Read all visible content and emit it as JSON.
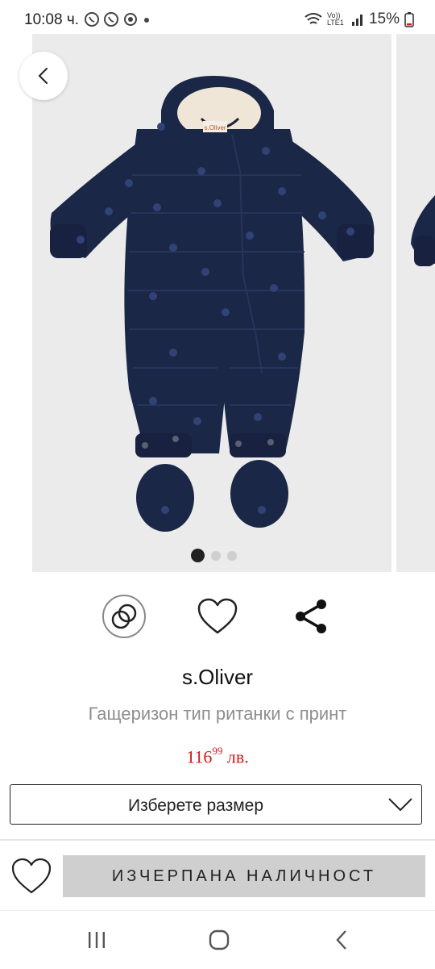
{
  "status_bar": {
    "time": "10:08 ч.",
    "network": "Vo)) LTE1",
    "battery": "15%"
  },
  "gallery": {
    "total_images": 3,
    "active_index": 0,
    "product_logo": "s.Oliver"
  },
  "product": {
    "brand": "s.Oliver",
    "name": "Гащеризон тип ританки с принт",
    "price_main": "116",
    "price_cents": "99",
    "price_currency": "лв."
  },
  "size_select": {
    "label": "Изберете размер"
  },
  "bottom_bar": {
    "out_of_stock_label": "ИЗЧЕРПАНА НАЛИЧНОСТ"
  },
  "colors": {
    "price": "#d21a1a",
    "garment": "#1b2746",
    "button_bg": "#cfcfcf"
  }
}
